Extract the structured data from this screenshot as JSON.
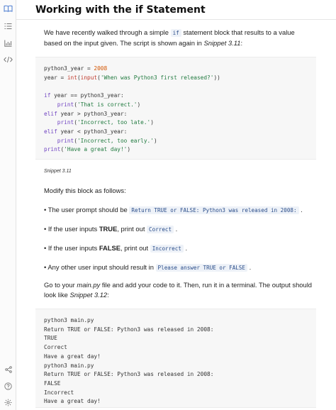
{
  "sidebar": {
    "icons": [
      "book-icon",
      "list-icon",
      "chart-icon",
      "code-icon",
      "share-icon",
      "help-icon",
      "settings-icon"
    ]
  },
  "header": {
    "title": "Working with the if Statement"
  },
  "intro": {
    "part1": "We have recently walked through a simple ",
    "code": "if",
    "part2": " statement block that results to a value based on the input given. The script is shown again in ",
    "ref": "Snippet 3.11",
    "part3": ":"
  },
  "snippet1": {
    "caption": "Snippet 3.11"
  },
  "task": {
    "heading": "Modify this block as follows:",
    "bullets": [
      {
        "pre": "• The user prompt should be ",
        "bold": "",
        "mid": "",
        "code": "Return TRUE or FALSE: Python3 was released in 2008:",
        "post": " ."
      },
      {
        "pre": "• If the user inputs ",
        "bold": "TRUE",
        "mid": ", print out ",
        "code": "Correct",
        "post": " ."
      },
      {
        "pre": "• If the user inputs ",
        "bold": "FALSE",
        "mid": ", print out ",
        "code": "Incorrect",
        "post": " ."
      },
      {
        "pre": "• Any other user input should result in ",
        "bold": "",
        "mid": "",
        "code": "Please answer TRUE or FALSE",
        "post": " ."
      }
    ]
  },
  "outro": {
    "part1": "Go to your ",
    "file": "main.py",
    "part2": " file and add your code to it. Then, run it in a terminal. The output should look like ",
    "ref": "Snippet 3.12",
    "part3": ":"
  },
  "output": {
    "lines": [
      "python3 main.py",
      "Return TRUE or FALSE: Python3 was released in 2008:",
      "TRUE",
      "Correct",
      "Have a great day!",
      "python3 main.py",
      "Return TRUE or FALSE: Python3 was released in 2008:",
      "FALSE",
      "Incorrect",
      "Have a great day!"
    ]
  }
}
